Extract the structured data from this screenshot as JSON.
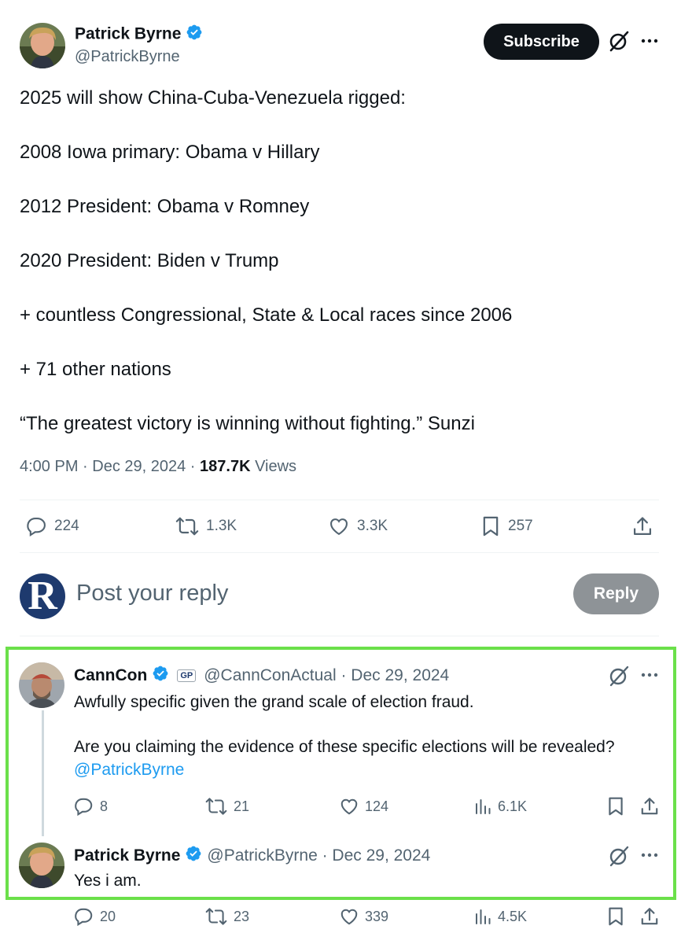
{
  "main_tweet": {
    "author_name": "Patrick Byrne",
    "author_handle": "@PatrickByrne",
    "subscribe_label": "Subscribe",
    "lines": [
      "2025 will show China-Cuba-Venezuela rigged:",
      "2008 Iowa primary: Obama v Hillary",
      "2012 President: Obama v Romney",
      "2020 President: Biden v Trump",
      "+ countless Congressional, State & Local races since 2006",
      "+ 71 other nations",
      "“The greatest victory is winning without fighting.” Sunzi"
    ],
    "time": "4:00 PM · Dec 29, 2024 · ",
    "views_count": "187.7K",
    "views_label": " Views",
    "actions": {
      "replies": "224",
      "reposts": "1.3K",
      "likes": "3.3K",
      "bookmarks": "257"
    }
  },
  "composer": {
    "avatar_letter": "R",
    "placeholder": "Post your reply",
    "reply_label": "Reply"
  },
  "reply_1": {
    "author_name": "CannCon",
    "badge": "GP",
    "handle_date": "@CannConActual · Dec 29, 2024",
    "line1": "Awfully specific given the grand scale of election fraud.",
    "line2": "Are you claiming the evidence of these specific elections will be revealed?",
    "mention": "@PatrickByrne",
    "actions": {
      "replies": "8",
      "reposts": "21",
      "likes": "124",
      "views": "6.1K"
    }
  },
  "reply_2": {
    "author_name": "Patrick Byrne",
    "handle_date": "@PatrickByrne · Dec 29, 2024",
    "text": "Yes i am.",
    "actions": {
      "replies": "20",
      "reposts": "23",
      "likes": "339",
      "views": "4.5K"
    }
  },
  "colors": {
    "accent": "#1d9bf0",
    "highlight": "#6be04a",
    "muted": "#536471"
  },
  "icons": [
    "verified-icon",
    "grok-icon",
    "more-icon",
    "reply-icon",
    "repost-icon",
    "like-icon",
    "bookmark-icon",
    "share-icon",
    "views-icon"
  ]
}
